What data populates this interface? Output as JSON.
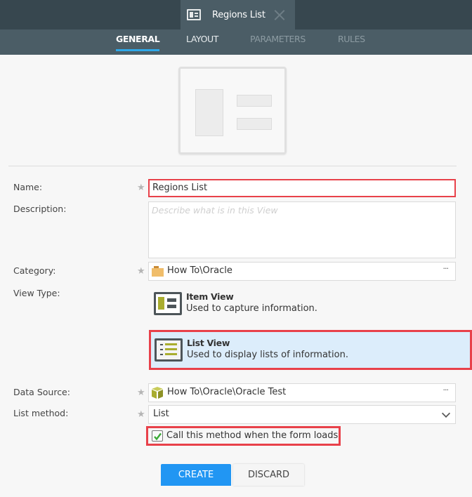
{
  "document_tab": {
    "title": "Regions List",
    "icon": "view-icon",
    "close_icon": "close-icon"
  },
  "nav_tabs": [
    {
      "label": "GENERAL",
      "active": true
    },
    {
      "label": "LAYOUT",
      "active": false
    },
    {
      "label": "PARAMETERS",
      "active": false,
      "disabled": true
    },
    {
      "label": "RULES",
      "active": false,
      "disabled": true
    }
  ],
  "form": {
    "name": {
      "label": "Name:",
      "value": "Regions List",
      "required": true
    },
    "description": {
      "label": "Description:",
      "placeholder": "Describe what is in this View",
      "value": ""
    },
    "category": {
      "label": "Category:",
      "value": "How To\\Oracle",
      "required": true,
      "icon": "folder-icon",
      "browse": "···"
    },
    "view_type": {
      "label": "View Type:",
      "options": [
        {
          "title": "Item View",
          "description": "Used to capture information.",
          "selected": false
        },
        {
          "title": "List View",
          "description": "Used to display lists of information.",
          "selected": true
        }
      ]
    },
    "data_source": {
      "label": "Data Source:",
      "value": "How To\\Oracle\\Oracle Test",
      "required": true,
      "icon": "smartobject-cube-icon",
      "browse": "···"
    },
    "list_method": {
      "label": "List method:",
      "value": "List",
      "required": true
    },
    "call_on_load": {
      "label": "Call this method when the form loads",
      "checked": true
    }
  },
  "buttons": {
    "create": "CREATE",
    "discard": "DISCARD"
  },
  "required_marker": "★",
  "colors": {
    "accent": "#2196f3",
    "highlight": "#e8414a",
    "selected_bg": "#dcedfb",
    "header": "#37474f",
    "subheader": "#4b5d66",
    "tab_underline": "#2ea8e8"
  }
}
